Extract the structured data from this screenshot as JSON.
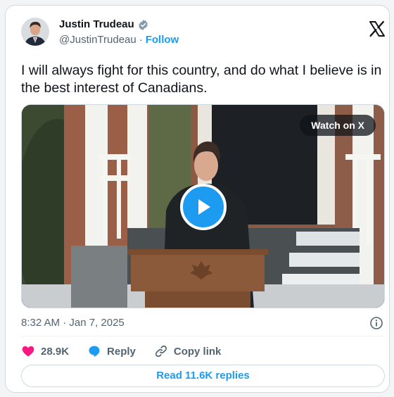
{
  "author": {
    "name": "Justin Trudeau",
    "handle": "@JustinTrudeau",
    "separator": "·",
    "follow_label": "Follow"
  },
  "tweet": {
    "text": "I will always fight for this country, and do what I believe is in the best interest of Canadians."
  },
  "media": {
    "watch_label": "Watch on X"
  },
  "meta": {
    "timestamp": "8:32 AM · Jan 7, 2025"
  },
  "actions": {
    "like_count": "28.9K",
    "reply_label": "Reply",
    "copy_label": "Copy link"
  },
  "footer": {
    "read_replies_label": "Read 11.6K replies"
  },
  "colors": {
    "accent": "#1d9bf0",
    "like": "#f91880",
    "text": "#0f1419",
    "muted": "#536471"
  },
  "icons": [
    "verified-badge-icon",
    "x-logo-icon",
    "play-icon",
    "info-icon",
    "heart-icon",
    "reply-bubble-icon",
    "link-icon"
  ]
}
